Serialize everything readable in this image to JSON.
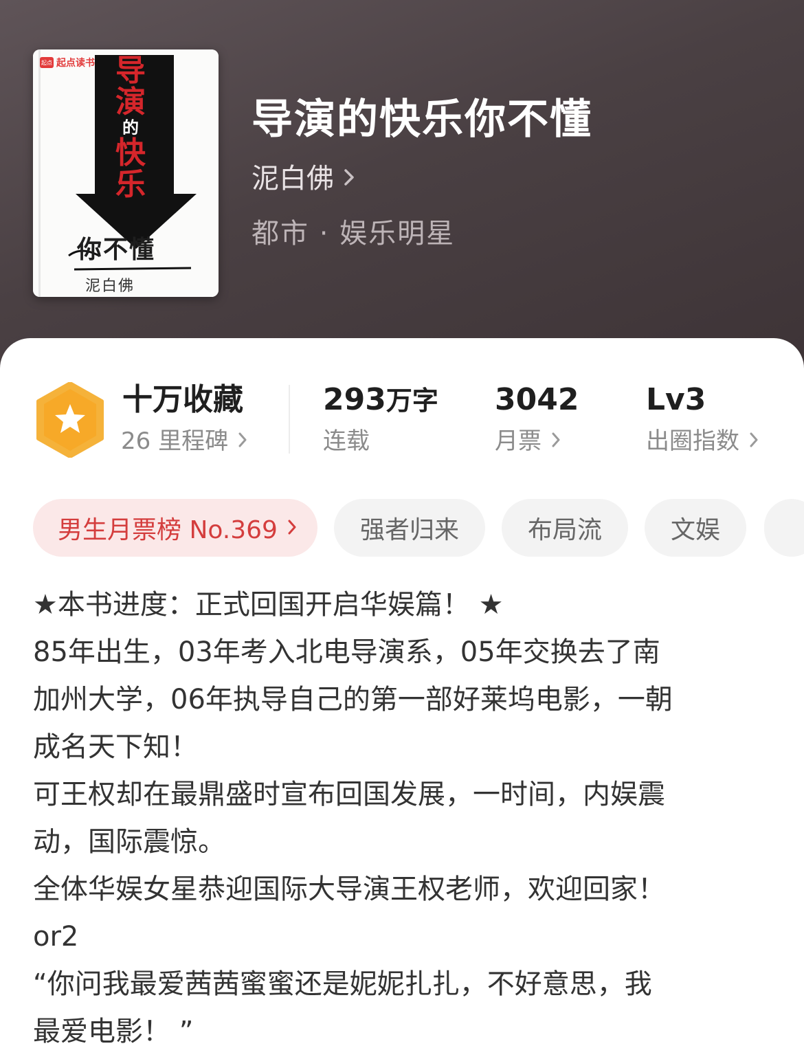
{
  "cover": {
    "brand": "起点读书",
    "brand_badge": "起点",
    "title_chars": [
      "导",
      "演",
      "的",
      "快",
      "乐"
    ],
    "subtitle": "你不懂",
    "author": "泥白佛"
  },
  "book": {
    "title": "导演的快乐你不懂",
    "author": "泥白佛",
    "category": "都市 · 娱乐明星"
  },
  "stats": {
    "collection": {
      "value": "十万收藏",
      "sub": "26 里程碑"
    },
    "words": {
      "value": "293",
      "unit": "万字",
      "sub": "连载"
    },
    "monthly_ticket": {
      "value": "3042",
      "sub": "月票"
    },
    "level": {
      "value": "Lv3",
      "sub": "出圈指数"
    }
  },
  "tags": {
    "rank": "男生月票榜 No.369",
    "items": [
      "强者归来",
      "布局流",
      "文娱"
    ]
  },
  "description": {
    "lines": [
      "★本书进度：正式回国开启华娱篇！ ★",
      "85年出生，03年考入北电导演系，05年交换去了南",
      "加州大学，06年执导自己的第一部好莱坞电影，一朝",
      "成名天下知！",
      "可王权却在最鼎盛时宣布回国发展，一时间，内娱震",
      "动，国际震惊。",
      "全体华娱女星恭迎国际大导演王权老师，欢迎回家！",
      "or2",
      "“你问我最爱茜茜蜜蜜还是妮妮扎扎，不好意思，我",
      "最爱电影！ ”"
    ]
  },
  "colors": {
    "hero_bg": "#4a4043",
    "rank_tag_bg": "#fbe8e8",
    "rank_tag_text": "#d43d3d",
    "badge_orange": "#f5a623"
  }
}
